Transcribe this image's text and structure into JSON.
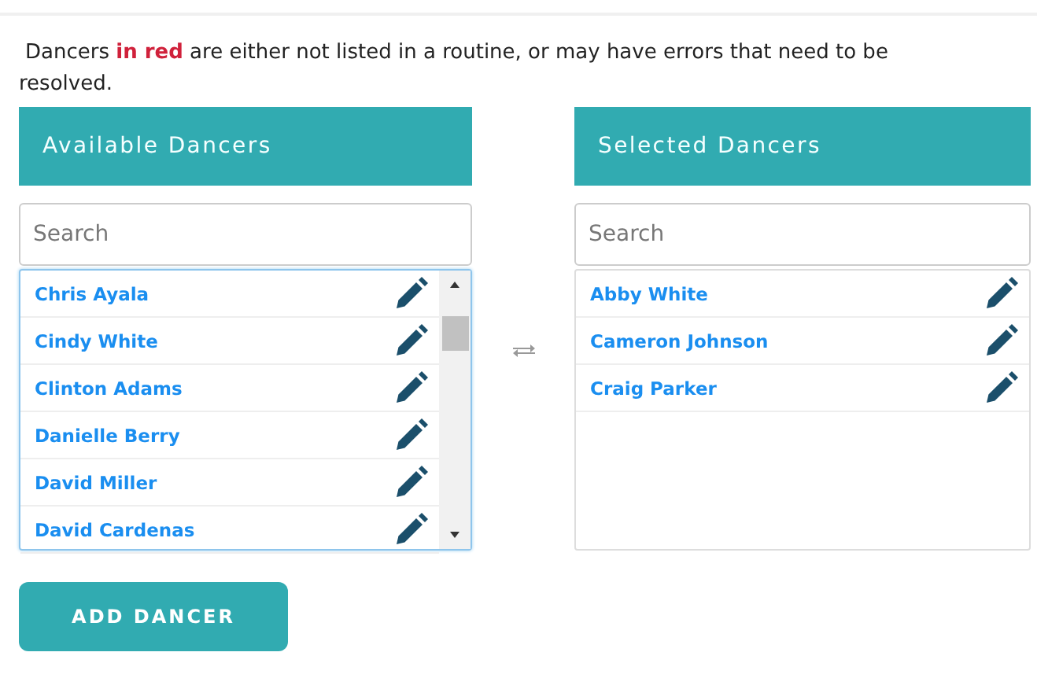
{
  "notice": {
    "before": "Dancers ",
    "highlight": "in red",
    "after": " are either not listed in a routine, or may have errors that need to be resolved."
  },
  "available": {
    "title": "Available Dancers",
    "search": {
      "placeholder": "Search"
    },
    "focused": true,
    "items": [
      {
        "name": "Chris Ayala"
      },
      {
        "name": "Cindy White"
      },
      {
        "name": "Clinton Adams"
      },
      {
        "name": "Danielle Berry"
      },
      {
        "name": "David Miller"
      },
      {
        "name": "David Cardenas"
      }
    ]
  },
  "selected": {
    "title": "Selected Dancers",
    "search": {
      "placeholder": "Search"
    },
    "focused": false,
    "items": [
      {
        "name": "Abby White"
      },
      {
        "name": "Cameron Johnson"
      },
      {
        "name": "Craig Parker"
      }
    ]
  },
  "add_button": "ADD DANCER"
}
